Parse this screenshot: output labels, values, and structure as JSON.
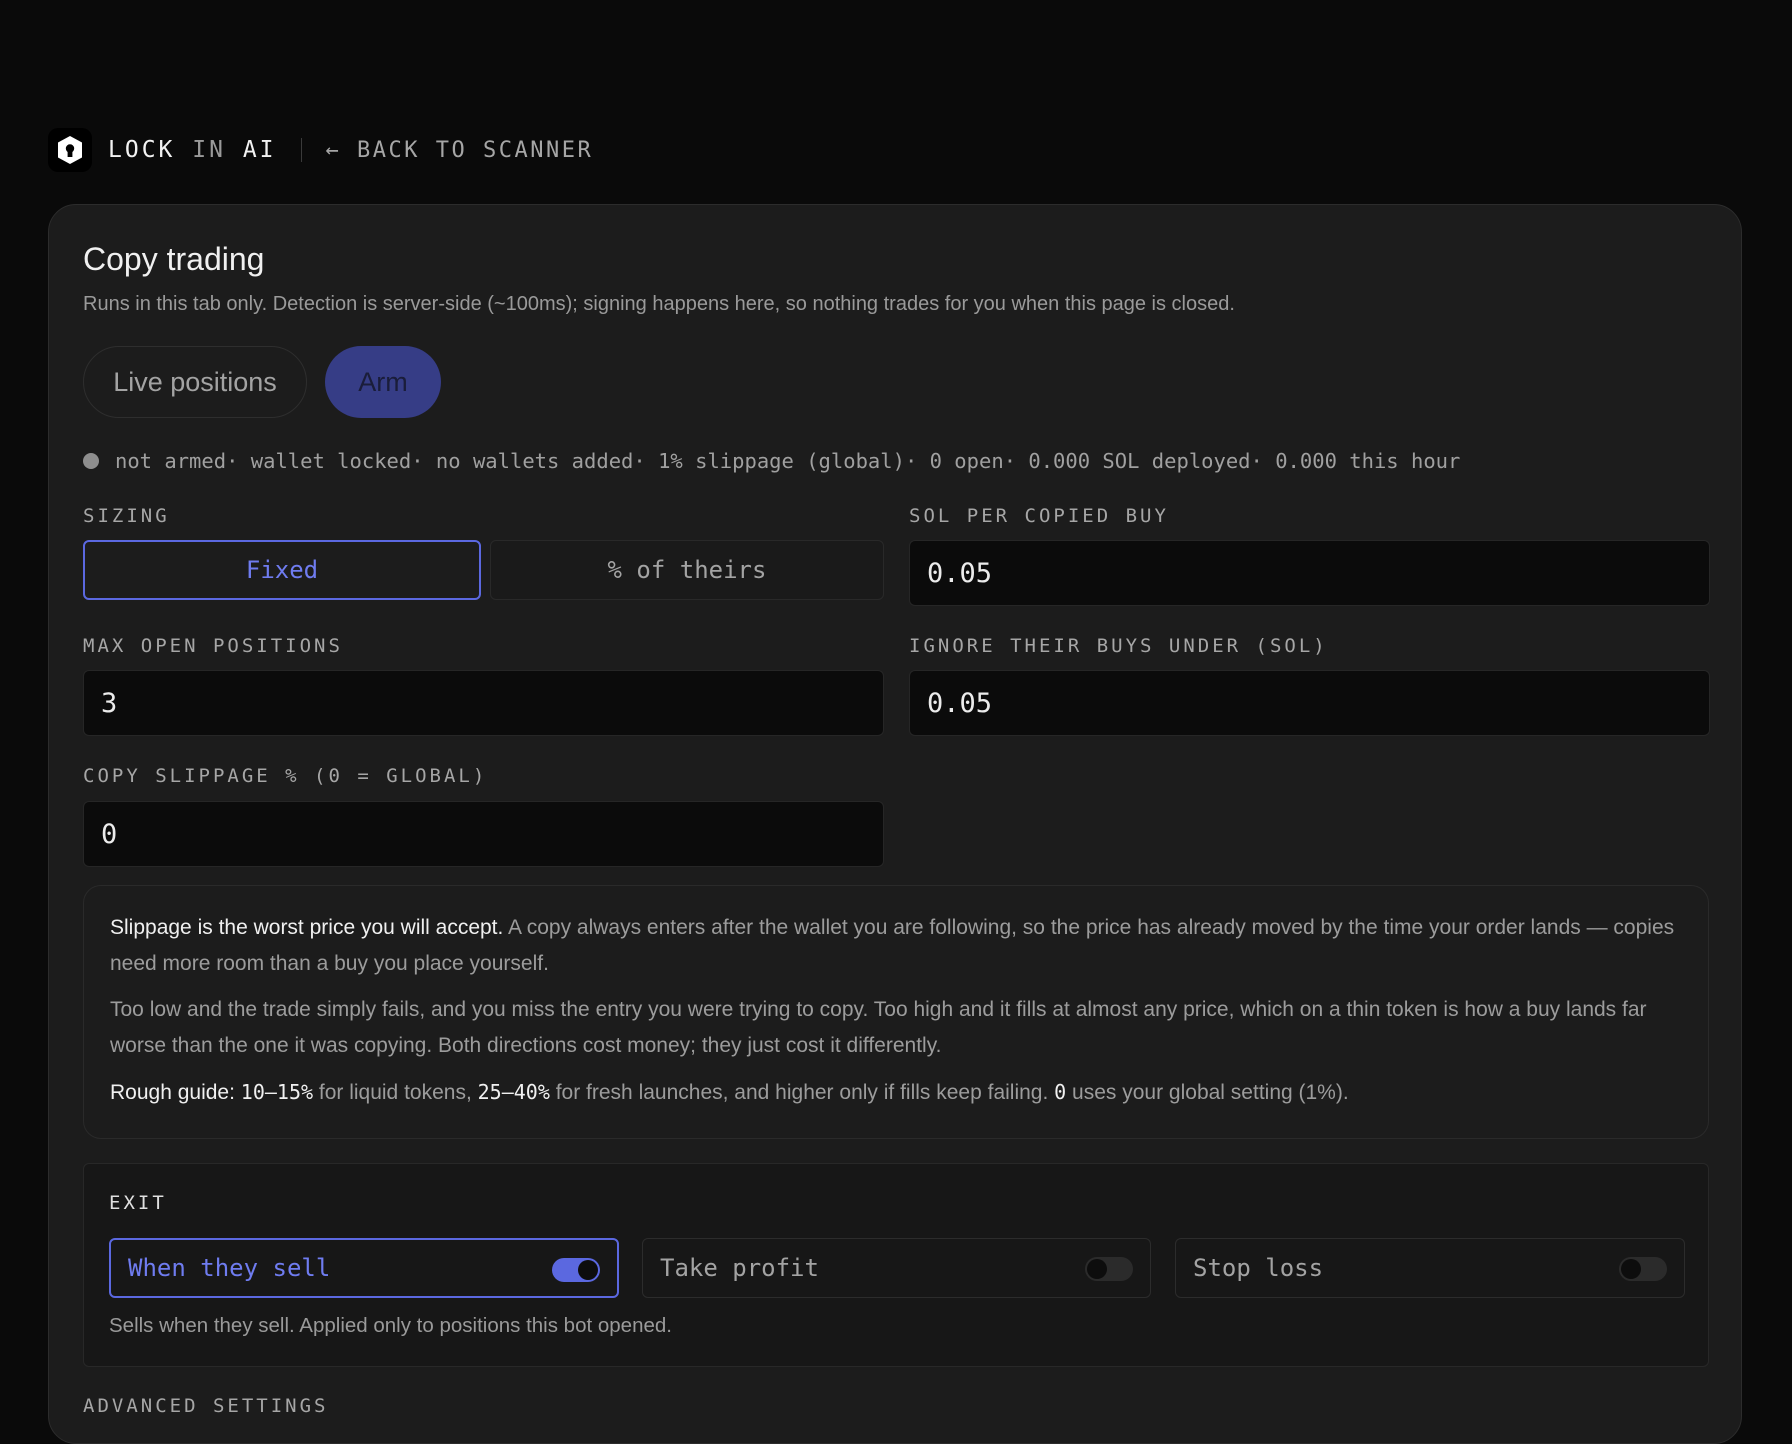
{
  "header": {
    "brand_lock": "LOCK",
    "brand_in": "IN",
    "brand_ai": "AI",
    "back_link": "← BACK TO SCANNER"
  },
  "page": {
    "title": "Copy trading",
    "subtitle": "Runs in this tab only. Detection is server-side (~100ms); signing happens here, so nothing trades for you when this page is closed."
  },
  "tabs": {
    "live": "Live positions",
    "arm": "Arm"
  },
  "status": {
    "armed": "not armed",
    "wallet": "· wallet locked",
    "wallets_added": "· no wallets added",
    "slippage": "· 1% slippage (global)",
    "open": "· 0 open",
    "deployed": "· 0.000 SOL deployed",
    "hour": "· 0.000 this hour"
  },
  "form": {
    "sizing_label": "SIZING",
    "sizing_fixed": "Fixed",
    "sizing_pct": "% of theirs",
    "sol_per_buy_label": "SOL PER COPIED BUY",
    "sol_per_buy_value": "0.05",
    "max_open_label": "MAX OPEN POSITIONS",
    "max_open_value": "3",
    "ignore_under_label": "IGNORE THEIR BUYS UNDER (SOL)",
    "ignore_under_value": "0.05",
    "copy_slippage_label": "COPY SLIPPAGE % (0 = GLOBAL)",
    "copy_slippage_value": "0"
  },
  "info": {
    "p1_strong": "Slippage is the worst price you will accept.",
    "p1_rest": " A copy always enters after the wallet you are following, so the price has already moved by the time your order lands — copies need more room than a buy you place yourself.",
    "p2": "Too low and the trade simply fails, and you miss the entry you were trying to copy. Too high and it fills at almost any price, which on a thin token is how a buy lands far worse than the one it was copying. Both directions cost money; they just cost it differently.",
    "p3_a": "Rough guide: ",
    "p3_b": "10–15%",
    "p3_c": " for liquid tokens, ",
    "p3_d": "25–40%",
    "p3_e": " for fresh launches, and higher only if fills keep failing. ",
    "p3_f": "0",
    "p3_g": " uses your global setting (1%)."
  },
  "exit": {
    "label": "EXIT",
    "when_they_sell": "When they sell",
    "when_they_sell_on": true,
    "take_profit": "Take profit",
    "take_profit_on": false,
    "stop_loss": "Stop loss",
    "stop_loss_on": false,
    "note": "Sells when they sell. Applied only to positions this bot opened."
  },
  "advanced": {
    "label": "ADVANCED SETTINGS"
  },
  "colors": {
    "accent": "#5b68e0",
    "arm_bg": "#363d86",
    "background": "#0a0a0a",
    "card": "#1c1c1c"
  }
}
